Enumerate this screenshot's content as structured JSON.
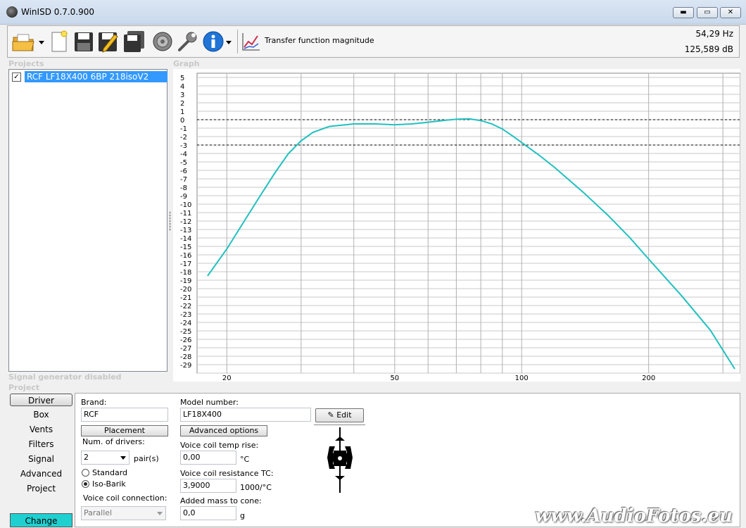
{
  "window": {
    "title": "WinISD 0.7.0.900"
  },
  "toolbar": {
    "view_label": "Transfer function magnitude",
    "frequency": "54,29 Hz",
    "level": "125,589 dB"
  },
  "sections": {
    "projects": "Projects",
    "graph": "Graph",
    "signal_generator": "Signal generator disabled",
    "project": "Project"
  },
  "projects": [
    {
      "name": "RCF LF18X400 6BP 218isoV2",
      "checked": true
    }
  ],
  "chart_data": {
    "type": "line",
    "xscale": "log",
    "xlim": [
      17,
      330
    ],
    "ylim": [
      -30,
      5.5
    ],
    "x_ticks": [
      20,
      50,
      100,
      200
    ],
    "y_ticks": [
      5,
      4,
      3,
      2,
      1,
      0,
      -1,
      -2,
      -3,
      -4,
      -5,
      -6,
      -7,
      -8,
      -9,
      -10,
      -11,
      -12,
      -13,
      -14,
      -15,
      -16,
      -17,
      -18,
      -19,
      -20,
      -21,
      -22,
      -23,
      -24,
      -25,
      -26,
      -27,
      -28,
      -29
    ],
    "reference_lines": [
      0,
      -3
    ],
    "grid": true,
    "series": [
      {
        "color": "#20c0c0",
        "x": [
          18,
          20,
          22,
          24,
          26,
          28,
          30,
          32,
          35,
          40,
          45,
          50,
          55,
          60,
          65,
          70,
          75,
          80,
          85,
          90,
          95,
          100,
          110,
          120,
          140,
          160,
          180,
          200,
          240,
          280,
          320
        ],
        "y": [
          -18.5,
          -15.3,
          -12.0,
          -9.0,
          -6.3,
          -4.0,
          -2.5,
          -1.5,
          -0.8,
          -0.5,
          -0.5,
          -0.6,
          -0.5,
          -0.3,
          -0.1,
          0.05,
          0.1,
          -0.1,
          -0.5,
          -1.1,
          -1.9,
          -2.7,
          -4.2,
          -5.7,
          -8.6,
          -11.3,
          -13.9,
          -16.5,
          -20.9,
          -24.9,
          -29.5
        ]
      }
    ]
  },
  "side_tabs": [
    "Driver",
    "Box",
    "Vents",
    "Filters",
    "Signal",
    "Advanced",
    "Project"
  ],
  "change_label": "Change",
  "driver": {
    "brand_label": "Brand:",
    "brand": "RCF",
    "model_label": "Model number:",
    "model": "LF18X400",
    "edit_label": "Edit",
    "placement_label": "Placement",
    "advanced_label": "Advanced options",
    "num_label": "Num. of drivers:",
    "num": "2",
    "num_unit": "pair(s)",
    "standard_label": "Standard",
    "isobarik_label": "Iso-Barik",
    "vc_conn_label": "Voice coil connection:",
    "vc_conn": "Parallel",
    "vc_temp_label": "Voice coil temp rise:",
    "vc_temp": "0,00",
    "vc_temp_unit": "°C",
    "vc_tc_label": "Voice coil resistance TC:",
    "vc_tc": "3,9000",
    "vc_tc_unit": "1000/°C",
    "mass_label": "Added mass to cone:",
    "mass": "0,0",
    "mass_unit": "g"
  },
  "watermark": "www.AudioFotos.eu"
}
